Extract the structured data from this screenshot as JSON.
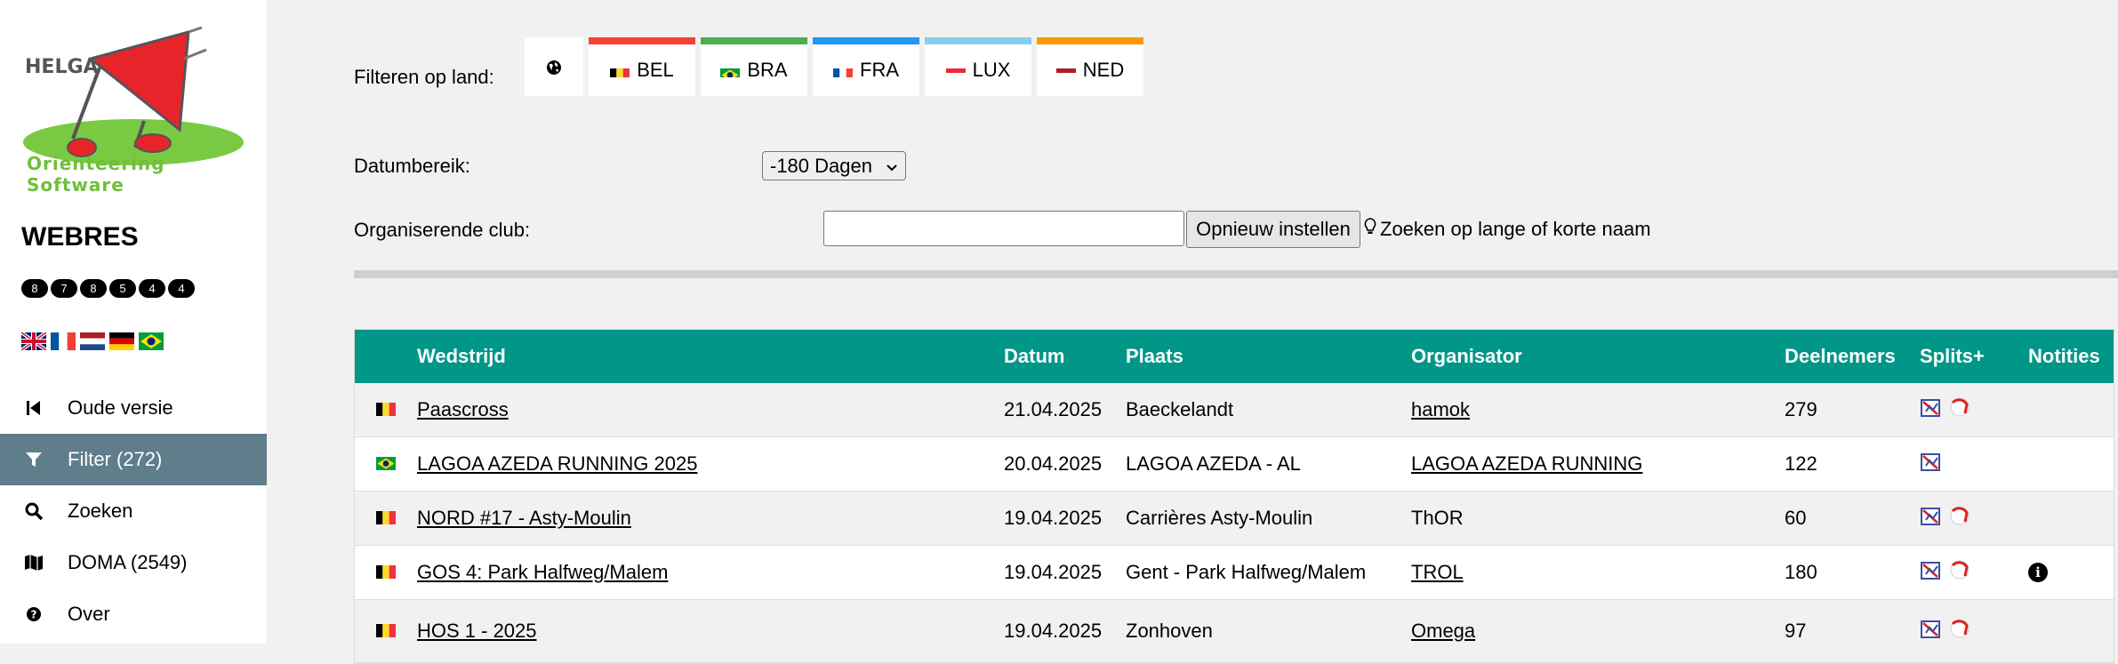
{
  "sidebar": {
    "logo_text": "Orienteering Software",
    "logo_brand": "HELGA",
    "app_title": "WEBRES",
    "badges": [
      "8",
      "7",
      "8",
      "5",
      "4",
      "4"
    ],
    "languages": [
      "en-flag-icon",
      "fr-flag-icon",
      "nl-flag-icon",
      "de-flag-icon",
      "br-flag-icon"
    ],
    "nav": [
      {
        "label": "Oude versie",
        "icon": "skip-back-icon"
      },
      {
        "label": "Filter (272)",
        "icon": "filter-icon",
        "active": true
      },
      {
        "label": "Zoeken",
        "icon": "search-icon"
      },
      {
        "label": "DOMA (2549)",
        "icon": "map-icon"
      },
      {
        "label": "Over",
        "icon": "help-circle-icon"
      }
    ]
  },
  "filters": {
    "country_label": "Filteren op land:",
    "countries": [
      {
        "code": "BEL",
        "color": "#f44336"
      },
      {
        "code": "BRA",
        "color": "#4caf50"
      },
      {
        "code": "FRA",
        "color": "#2196f3"
      },
      {
        "code": "LUX",
        "color": "#87ceeb"
      },
      {
        "code": "NED",
        "color": "#ff9800"
      }
    ],
    "date_label": "Datumbereik:",
    "date_value": "-180 Dagen",
    "club_label": "Organiserende club:",
    "club_value": "",
    "reset_label": "Opnieuw instellen",
    "hint": "Zoeken op lange of korte naam"
  },
  "table": {
    "headers": {
      "name": "Wedstrijd",
      "date": "Datum",
      "place": "Plaats",
      "organizer": "Organisator",
      "participants": "Deelnemers",
      "splits": "Splits+",
      "notes": "Notities"
    },
    "rows": [
      {
        "flag": "BEL",
        "name": "Paascross",
        "date": "21.04.2025",
        "place": "Baeckelandt",
        "organizer": "hamok",
        "organizer_link": true,
        "participants": "279",
        "rg": true,
        "info": false
      },
      {
        "flag": "BRA",
        "name": "LAGOA AZEDA RUNNING 2025",
        "date": "20.04.2025",
        "place": "LAGOA AZEDA - AL",
        "organizer": "LAGOA AZEDA RUNNING",
        "organizer_link": true,
        "participants": "122",
        "rg": false,
        "info": false
      },
      {
        "flag": "BEL",
        "name": "NORD #17 - Asty-Moulin",
        "date": "19.04.2025",
        "place": "Carrières Asty-Moulin",
        "organizer": "ThOR",
        "organizer_link": false,
        "participants": "60",
        "rg": true,
        "info": false
      },
      {
        "flag": "BEL",
        "name": "GOS 4: Park Halfweg/Malem",
        "date": "19.04.2025",
        "place": "Gent - Park Halfweg/Malem",
        "organizer": "TROL",
        "organizer_link": true,
        "participants": "180",
        "rg": true,
        "info": true
      },
      {
        "flag": "BEL",
        "name": "HOS 1 - 2025",
        "date": "19.04.2025",
        "place": "Zonhoven",
        "organizer": "Omega",
        "organizer_link": true,
        "participants": "97",
        "rg": true,
        "info": false
      }
    ]
  }
}
